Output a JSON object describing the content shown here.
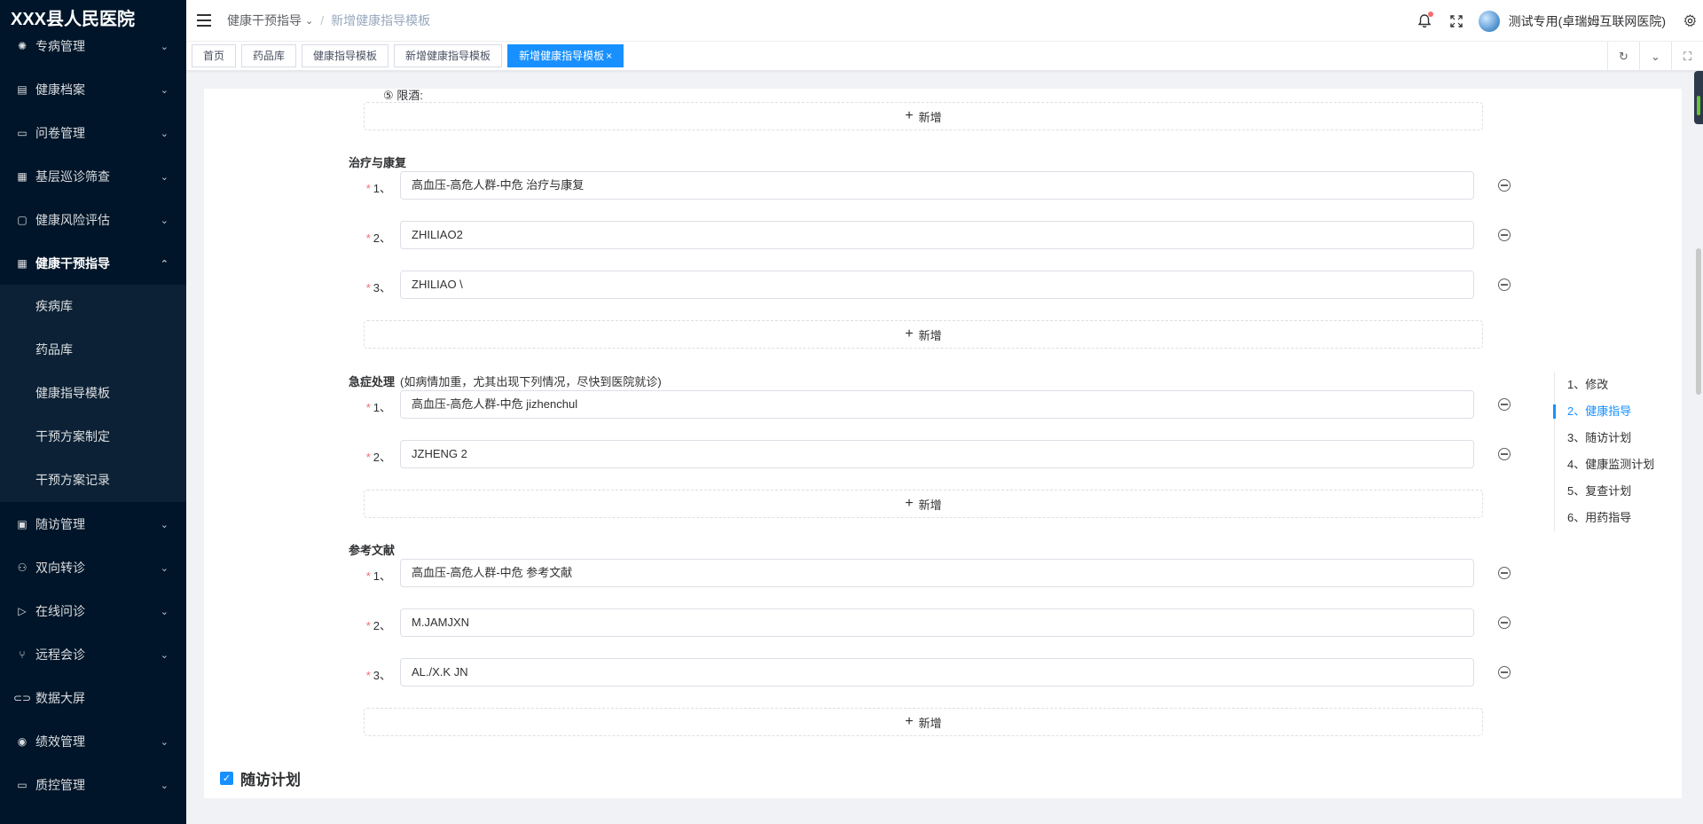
{
  "sidebar": {
    "logo": "XXX县人民医院",
    "items": [
      {
        "label": "专病管理",
        "icon": "virus-icon"
      },
      {
        "label": "健康档案",
        "icon": "document-icon"
      },
      {
        "label": "问卷管理",
        "icon": "questionnaire-icon"
      },
      {
        "label": "基层巡诊筛查",
        "icon": "screening-icon"
      },
      {
        "label": "健康风险评估",
        "icon": "risk-icon"
      },
      {
        "label": "健康干预指导",
        "icon": "table-icon"
      }
    ],
    "subitems": [
      "疾病库",
      "药品库",
      "健康指导模板",
      "干预方案制定",
      "干预方案记录"
    ],
    "items_after": [
      {
        "label": "随访管理",
        "icon": "grid-icon"
      },
      {
        "label": "双向转诊",
        "icon": "referral-icon"
      },
      {
        "label": "在线问诊",
        "icon": "send-icon"
      },
      {
        "label": "远程会诊",
        "icon": "branch-icon"
      },
      {
        "label": "数据大屏",
        "icon": "link-icon"
      },
      {
        "label": "绩效管理",
        "icon": "chart-circle-icon"
      },
      {
        "label": "质控管理",
        "icon": "monitor-icon"
      }
    ]
  },
  "header": {
    "breadcrumb": [
      "健康干预指导",
      "新增健康指导模板"
    ],
    "user_name": "测试专用(卓瑞姆互联网医院)"
  },
  "tabs": [
    {
      "label": "首页",
      "active": false
    },
    {
      "label": "药品库",
      "active": false
    },
    {
      "label": "健康指导模板",
      "active": false
    },
    {
      "label": "新增健康指导模板",
      "active": false
    },
    {
      "label": "新增健康指导模板",
      "active": true,
      "close": "×"
    }
  ],
  "form": {
    "cut_text": "⑤ 限酒:",
    "add_label": "新增",
    "treatment": {
      "title": "治疗与康复",
      "rows": [
        {
          "index": "1、",
          "value": "高血压-高危人群-中危 治疗与康复"
        },
        {
          "index": "2、",
          "value": "ZHILIAO2"
        },
        {
          "index": "3、",
          "value": "ZHILIAO \\"
        }
      ]
    },
    "emergency": {
      "title": "急症处理",
      "hint": "(如病情加重，尤其出现下列情况，尽快到医院就诊)",
      "rows": [
        {
          "index": "1、",
          "value": "高血压-高危人群-中危 jizhenchul"
        },
        {
          "index": "2、",
          "value": "JZHENG 2"
        }
      ]
    },
    "references": {
      "title": "参考文献",
      "rows": [
        {
          "index": "1、",
          "value": "高血压-高危人群-中危 参考文献"
        },
        {
          "index": "2、",
          "value": "M.JAMJXN"
        },
        {
          "index": "3、",
          "value": "AL./X.K JN"
        }
      ]
    },
    "followup": {
      "label": "随访计划",
      "checked": true
    }
  },
  "anchor_nav": [
    {
      "label": "1、修改",
      "active": false
    },
    {
      "label": "2、健康指导",
      "active": true
    },
    {
      "label": "3、随访计划",
      "active": false
    },
    {
      "label": "4、健康监测计划",
      "active": false
    },
    {
      "label": "5、复查计划",
      "active": false
    },
    {
      "label": "6、用药指导",
      "active": false
    }
  ],
  "colors": {
    "primary": "#1890ff",
    "sidebar": "#001529",
    "required": "#f56c6c"
  }
}
